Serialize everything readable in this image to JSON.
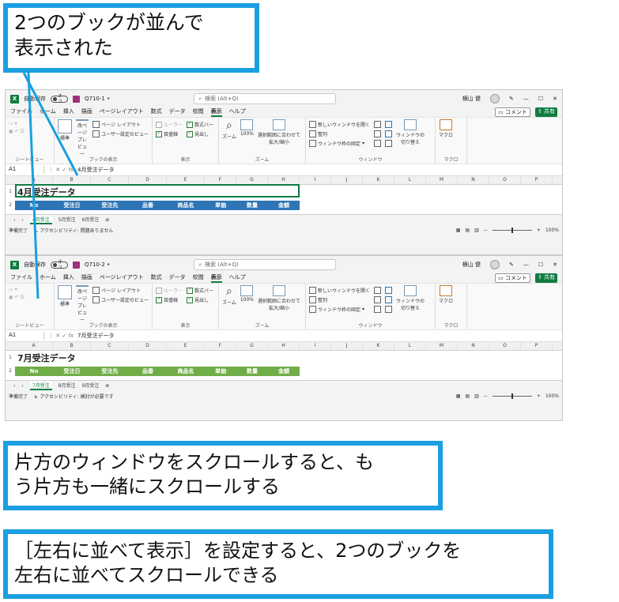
{
  "callouts": {
    "top": [
      "2つのブックが並んで",
      "表示された"
    ],
    "middle": [
      "片方のウィンドウをスクロールすると、も",
      "う片方も一緒にスクロールする"
    ],
    "bottom": [
      "［左右に並べて表示］を設定すると、2つのブックを",
      "左右に並べてスクロールできる"
    ]
  },
  "colors": {
    "accent_blue": "#1a9fe0",
    "excel_green": "#107c41",
    "header_blue": "#2e75b6",
    "header_green": "#70ad47"
  },
  "windows": [
    {
      "autosave": "自動保存",
      "toggle": "オフ",
      "filename": "Q710-1 •",
      "search": "検索 (Alt+Q)",
      "user": "横山 健",
      "menu": [
        "ファイル",
        "ホーム",
        "挿入",
        "描画",
        "ページレイアウト",
        "数式",
        "データ",
        "校閲",
        "表示",
        "ヘルプ"
      ],
      "comment": "コメント",
      "share": "共有",
      "ribbon": {
        "sheetview_label": "シートビュー",
        "normal": "標準",
        "pagebreak": "改ページ\nプレビュー",
        "pagelayout": "ページ レイアウト",
        "userview": "ユーザー設定のビュー",
        "bookview_label": "ブックの表示",
        "ruler": "ルーラー",
        "formulabar": "数式バー",
        "gridlines": "目盛線",
        "headings": "見出し",
        "show_label": "表示",
        "zoom": "ズーム",
        "zoom100": "100%",
        "zoomsel": "選択範囲に合わせて\n拡大/縮小",
        "zoom_label": "ズーム",
        "newwin": "新しいウィンドウを開く",
        "arrange": "整列",
        "freeze": "ウィンドウ枠の固定",
        "switch": "ウィンドウの\n切り替え",
        "window_label": "ウィンドウ",
        "macro": "マクロ",
        "macro_label": "マクロ"
      },
      "cell_ref": "A1",
      "formula": "4月受注データ",
      "columns": [
        "A",
        "B",
        "C",
        "D",
        "E",
        "F",
        "G",
        "H",
        "I",
        "J",
        "K",
        "L",
        "M",
        "N",
        "O",
        "P"
      ],
      "title": "4月受注データ",
      "headers": [
        "No",
        "受注日",
        "受注先",
        "品番",
        "商品名",
        "単価",
        "数量",
        "金額"
      ],
      "sheets": [
        "4月受注",
        "5月受注",
        "6月受注"
      ],
      "status_ready": "準備完了",
      "status_access": "アクセシビリティ: 問題ありません",
      "zoom_pct": "100%"
    },
    {
      "autosave": "自動保存",
      "toggle": "オフ",
      "filename": "Q710-2 •",
      "search": "検索 (Alt+Q)",
      "user": "横山 健",
      "menu": [
        "ファイル",
        "ホーム",
        "挿入",
        "描画",
        "ページレイアウト",
        "数式",
        "データ",
        "校閲",
        "表示",
        "ヘルプ"
      ],
      "comment": "コメント",
      "share": "共有",
      "ribbon": {
        "sheetview_label": "シートビュー",
        "normal": "標準",
        "pagebreak": "改ページ\nプレビュー",
        "pagelayout": "ページ レイアウト",
        "userview": "ユーザー設定のビュー",
        "bookview_label": "ブックの表示",
        "ruler": "ルーラー",
        "formulabar": "数式バー",
        "gridlines": "目盛線",
        "headings": "見出し",
        "show_label": "表示",
        "zoom": "ズーム",
        "zoom100": "100%",
        "zoomsel": "選択範囲に合わせて\n拡大/縮小",
        "zoom_label": "ズーム",
        "newwin": "新しいウィンドウを開く",
        "arrange": "整列",
        "freeze": "ウィンドウ枠の固定",
        "switch": "ウィンドウの\n切り替え",
        "window_label": "ウィンドウ",
        "macro": "マクロ",
        "macro_label": "マクロ"
      },
      "cell_ref": "A1",
      "formula": "7月受注データ",
      "columns": [
        "A",
        "B",
        "C",
        "D",
        "E",
        "F",
        "G",
        "H",
        "I",
        "J",
        "K",
        "L",
        "M",
        "N",
        "O",
        "P"
      ],
      "title": "7月受注データ",
      "headers": [
        "No",
        "受注日",
        "受注先",
        "品番",
        "商品名",
        "単価",
        "数量",
        "金額"
      ],
      "sheets": [
        "7月受注",
        "8月受注",
        "9月受注"
      ],
      "status_ready": "準備完了",
      "status_access": "アクセシビリティ: 検討が必要です",
      "zoom_pct": "100%"
    }
  ]
}
